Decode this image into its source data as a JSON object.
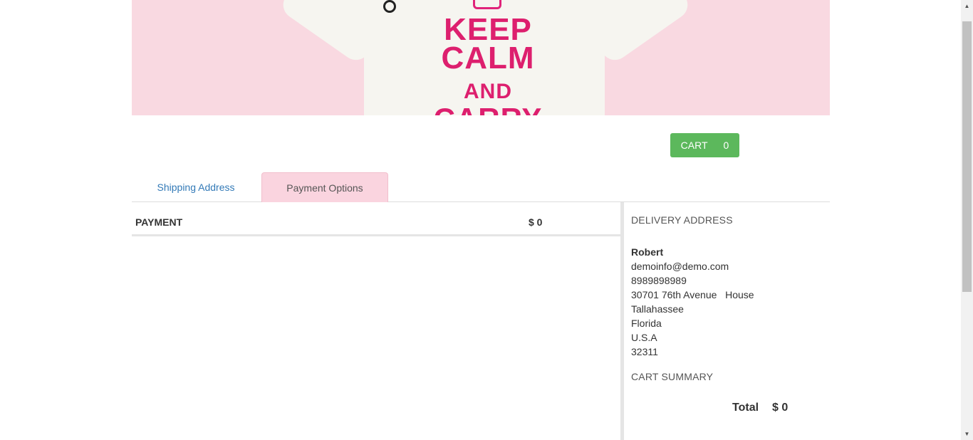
{
  "banner": {
    "slogan": [
      "KEEP",
      "CALM",
      "AND",
      "CARRY"
    ]
  },
  "cart": {
    "label": "CART",
    "count": "0"
  },
  "tabs": [
    {
      "label": "Shipping Address",
      "active": false
    },
    {
      "label": "Payment Options",
      "active": true
    }
  ],
  "payment": {
    "label": "PAYMENT",
    "amount": "$ 0"
  },
  "delivery": {
    "title": "DELIVERY ADDRESS",
    "name": "Robert",
    "email": "demoinfo@demo.com",
    "phone": "8989898989",
    "street": "30701 76th Avenue   House",
    "city": "Tallahassee",
    "state": "Florida",
    "country": "U.S.A",
    "zip": "32311"
  },
  "summary": {
    "title": "CART SUMMARY",
    "total_label": "Total",
    "total_value": "$ 0"
  },
  "colors": {
    "banner_bg": "#f9d9e1",
    "slogan": "#dd1f6e",
    "cart_button": "#5cb85c",
    "active_tab": "#fad4df",
    "link": "#337ab7"
  }
}
